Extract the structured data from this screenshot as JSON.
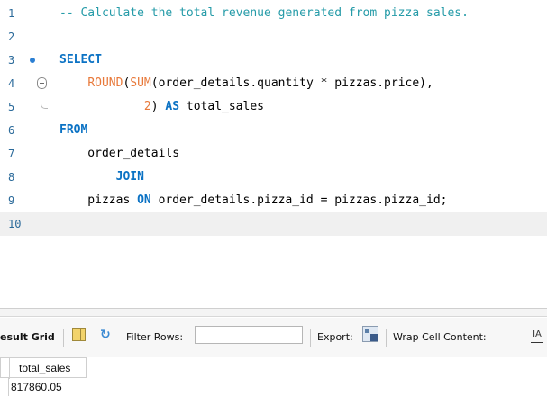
{
  "editor": {
    "lines": [
      {
        "num": "1",
        "parts": [
          {
            "t": "-- Calculate the total revenue generated from pizza sales.",
            "c": "cmt"
          }
        ]
      },
      {
        "num": "2",
        "parts": []
      },
      {
        "num": "3",
        "parts": [
          {
            "t": "SELECT",
            "c": "kw"
          }
        ]
      },
      {
        "num": "4",
        "parts": [
          {
            "t": "    "
          },
          {
            "t": "ROUND",
            "c": "fn"
          },
          {
            "t": "("
          },
          {
            "t": "SUM",
            "c": "fn"
          },
          {
            "t": "(order_details.quantity * pizzas.price),"
          }
        ]
      },
      {
        "num": "5",
        "parts": [
          {
            "t": "            "
          },
          {
            "t": "2",
            "c": "num"
          },
          {
            "t": ") "
          },
          {
            "t": "AS",
            "c": "kw"
          },
          {
            "t": " total_sales"
          }
        ]
      },
      {
        "num": "6",
        "parts": [
          {
            "t": "FROM",
            "c": "kw"
          }
        ]
      },
      {
        "num": "7",
        "parts": [
          {
            "t": "    order_details"
          }
        ]
      },
      {
        "num": "8",
        "parts": [
          {
            "t": "        "
          },
          {
            "t": "JOIN",
            "c": "kw"
          }
        ]
      },
      {
        "num": "9",
        "parts": [
          {
            "t": "    pizzas "
          },
          {
            "t": "ON",
            "c": "kw"
          },
          {
            "t": " order_details.pizza_id = pizzas.pizza_id;"
          }
        ]
      },
      {
        "num": "10",
        "parts": []
      }
    ]
  },
  "toolbar": {
    "result_grid_label": "esult Grid",
    "filter_rows_label": "Filter Rows:",
    "filter_rows_value": "",
    "export_label": "Export:",
    "wrap_cell_label": "Wrap Cell Content:",
    "wrap_icon_glyph": "IA",
    "filter_icon_glyph": "↻"
  },
  "result_grid": {
    "columns": [
      "total_sales"
    ],
    "rows": [
      [
        "817860.05"
      ]
    ]
  }
}
